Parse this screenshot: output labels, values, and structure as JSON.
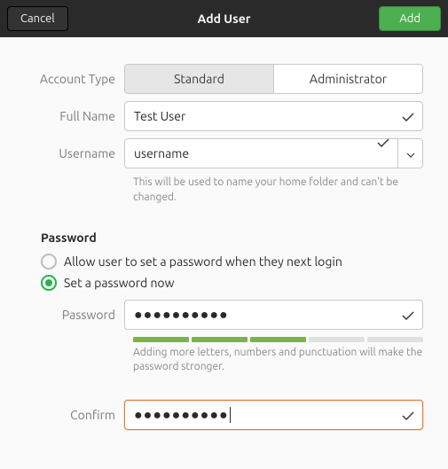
{
  "header": {
    "cancel_label": "Cancel",
    "title": "Add User",
    "add_label": "Add"
  },
  "form": {
    "account_type_label": "Account Type",
    "standard_label": "Standard",
    "administrator_label": "Administrator",
    "full_name_label": "Full Name",
    "full_name_value": "Test User",
    "username_label": "Username",
    "username_value": "username",
    "username_hint": "This will be used to name your home folder and can't be changed."
  },
  "password": {
    "section_title": "Password",
    "option_next_login": "Allow user to set a password when they next login",
    "option_now": "Set a password now",
    "password_label": "Password",
    "password_value": "●●●●●●●●●●",
    "strength_hint": "Adding more letters, numbers and punctuation will make the password stronger.",
    "confirm_label": "Confirm",
    "confirm_value": "●●●●●●●●●●",
    "strength_filled": 3,
    "strength_total": 5
  }
}
